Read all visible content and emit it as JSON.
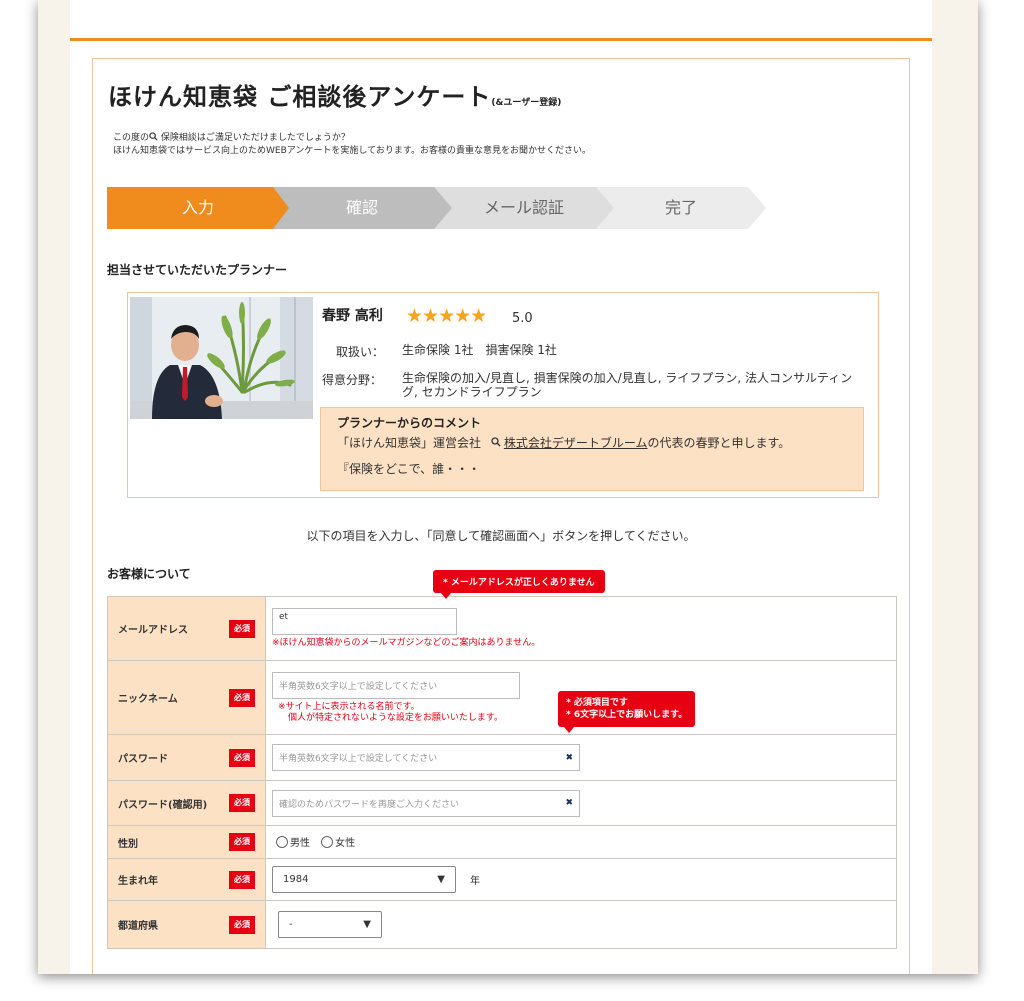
{
  "page": {
    "title": "ほけん知恵袋 ご相談後アンケート",
    "title_sub": "(&ユーザー登録)",
    "intro_line1_pre": "この度の",
    "intro_line1_post": "保険相談はご満足いただけましたでしょうか？",
    "intro_line2": "ほけん知恵袋ではサービス向上のためWEBアンケートを実施しております。お客様の貴重な意見をお聞かせください。"
  },
  "steps": [
    {
      "label": "入力",
      "active": true
    },
    {
      "label": "確認",
      "active": false
    },
    {
      "label": "メール認証",
      "active": false
    },
    {
      "label": "完了",
      "active": false
    }
  ],
  "planner": {
    "section_title": "担当させていただいたプランナー",
    "name": "春野 高利",
    "stars": "★★★★★",
    "rating": "5.0",
    "handling_label": "取扱い：",
    "handling_value": "生命保険 1社　損害保険 1社",
    "specialty_label": "得意分野：",
    "specialty_value": "生命保険の加入/見直し, 損害保険の加入/見直し, ライフプラン, 法人コンサルティング, セカンドライフプラン",
    "comment_title": "プランナーからのコメント",
    "comment_pre": "「ほけん知恵袋」運営会社",
    "comment_link": "株式会社デザートブルーム",
    "comment_post": "の代表の春野と申します。",
    "comment_line2": "『保険をどこで、誰・・・"
  },
  "form": {
    "instruction": "以下の項目を入力し、「同意して確認画面へ」ボタンを押してください。",
    "section_title": "お客様について",
    "required_badge": "必須",
    "email_error": "* メールアドレスが正しくありません",
    "password_error_line1": "* 必須項目です",
    "password_error_line2": "* 6文字以上でお願いします。",
    "email_label": "メールアドレス",
    "email_value": "et",
    "email_note": "※ほけん知恵袋からのメールマガジンなどのご案内はありません。",
    "nickname_label": "ニックネーム",
    "nickname_placeholder": "半角英数6文字以上で設定してください",
    "nickname_note_line1": "※サイト上に表示される名前です。",
    "nickname_note_line2": "個人が特定されないような設定をお願いいたします。",
    "password_label": "パスワード",
    "password_placeholder": "半角英数6文字以上で設定してください",
    "password_confirm_label": "パスワード(確認用)",
    "password_confirm_placeholder": "確認のためパスワードを再度ご入力ください",
    "gender_label": "性別",
    "gender_male": "男性",
    "gender_female": "女性",
    "birth_year_label": "生まれ年",
    "birth_year_value": "1984",
    "birth_year_unit": "年",
    "prefecture_label": "都道府県",
    "prefecture_value": "-"
  },
  "icons": {
    "search": "search-icon",
    "password_toggle": "password-toggle-icon",
    "dropdown": "▼"
  }
}
